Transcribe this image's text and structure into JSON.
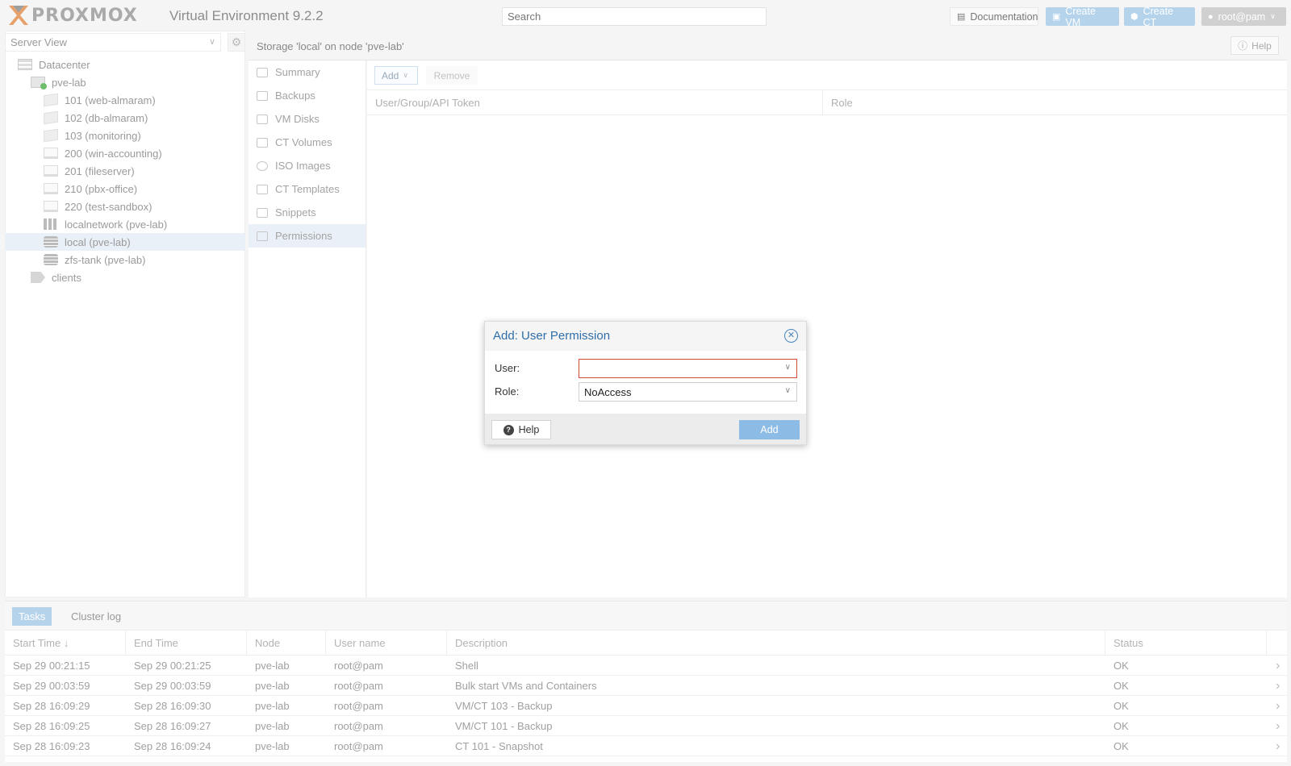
{
  "topbar": {
    "brand": "PROXMOX",
    "version": "Virtual Environment 9.2.2",
    "search_placeholder": "Search",
    "documentation": "Documentation",
    "create_vm": "Create VM",
    "create_ct": "Create CT",
    "user": "root@pam"
  },
  "left": {
    "view": "Server View",
    "tree": [
      {
        "label": "Datacenter",
        "icon": "datacenter-icon",
        "level": 0
      },
      {
        "label": "pve-lab",
        "icon": "node-online-icon",
        "level": 1
      },
      {
        "label": "101 (web-almaram)",
        "icon": "container-icon",
        "level": 2
      },
      {
        "label": "102 (db-almaram)",
        "icon": "container-icon",
        "level": 2
      },
      {
        "label": "103 (monitoring)",
        "icon": "container-icon",
        "level": 2
      },
      {
        "label": "200 (win-accounting)",
        "icon": "vm-icon",
        "level": 2
      },
      {
        "label": "201 (fileserver)",
        "icon": "vm-icon",
        "level": 2
      },
      {
        "label": "210 (pbx-office)",
        "icon": "vm-icon",
        "level": 2
      },
      {
        "label": "220 (test-sandbox)",
        "icon": "vm-icon",
        "level": 2
      },
      {
        "label": "localnetwork (pve-lab)",
        "icon": "network-icon",
        "level": 2
      },
      {
        "label": "local (pve-lab)",
        "icon": "storage-icon",
        "level": 2,
        "selected": true
      },
      {
        "label": "zfs-tank (pve-lab)",
        "icon": "storage-icon",
        "level": 2
      },
      {
        "label": "clients",
        "icon": "tag-icon",
        "level": 1
      }
    ]
  },
  "content": {
    "title": "Storage 'local' on node 'pve-lab'",
    "help": "Help",
    "nav": [
      {
        "label": "Summary",
        "icon": "summary-icon"
      },
      {
        "label": "Backups",
        "icon": "backup-icon"
      },
      {
        "label": "VM Disks",
        "icon": "disk-icon"
      },
      {
        "label": "CT Volumes",
        "icon": "volume-icon"
      },
      {
        "label": "ISO Images",
        "icon": "disc-icon"
      },
      {
        "label": "CT Templates",
        "icon": "template-icon"
      },
      {
        "label": "Snippets",
        "icon": "snippet-icon"
      },
      {
        "label": "Permissions",
        "icon": "unlock-icon",
        "selected": true
      }
    ],
    "toolbar": {
      "add": "Add",
      "remove": "Remove"
    },
    "grid_columns": [
      "User/Group/API Token",
      "Role"
    ]
  },
  "modal": {
    "title": "Add: User Permission",
    "user_label": "User:",
    "user_value": "",
    "role_label": "Role:",
    "role_value": "NoAccess",
    "help": "Help",
    "add": "Add"
  },
  "bottom": {
    "tabs": [
      "Tasks",
      "Cluster log"
    ],
    "columns": [
      "Start Time ↓",
      "End Time",
      "Node",
      "User name",
      "Description",
      "Status"
    ],
    "rows": [
      {
        "start": "Sep 29 00:21:15",
        "end": "Sep 29 00:21:25",
        "node": "pve-lab",
        "user": "root@pam",
        "desc": "Shell",
        "status": "OK"
      },
      {
        "start": "Sep 29 00:03:59",
        "end": "Sep 29 00:03:59",
        "node": "pve-lab",
        "user": "root@pam",
        "desc": "Bulk start VMs and Containers",
        "status": "OK"
      },
      {
        "start": "Sep 28 16:09:29",
        "end": "Sep 28 16:09:30",
        "node": "pve-lab",
        "user": "root@pam",
        "desc": "VM/CT 103 - Backup",
        "status": "OK"
      },
      {
        "start": "Sep 28 16:09:25",
        "end": "Sep 28 16:09:27",
        "node": "pve-lab",
        "user": "root@pam",
        "desc": "VM/CT 101 - Backup",
        "status": "OK"
      },
      {
        "start": "Sep 28 16:09:23",
        "end": "Sep 28 16:09:24",
        "node": "pve-lab",
        "user": "root@pam",
        "desc": "CT 101 - Snapshot",
        "status": "OK"
      }
    ]
  },
  "colors": {
    "accent": "#2f6ea7",
    "button_primary": "#8cbbe5",
    "invalid": "#cf4c35",
    "logo_orange": "#e8a06b"
  }
}
